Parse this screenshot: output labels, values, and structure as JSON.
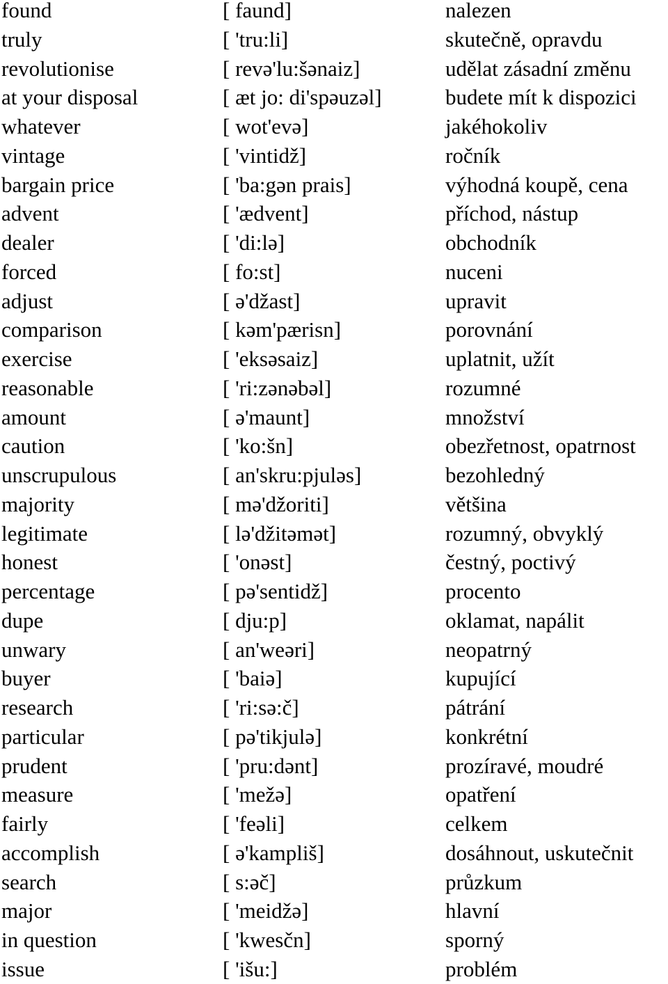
{
  "vocabulary": [
    {
      "word": "found",
      "pronunciation": "[ faund]",
      "translation": "nalezen"
    },
    {
      "word": "truly",
      "pronunciation": "[ 'tru:li]",
      "translation": "skutečně, opravdu"
    },
    {
      "word": "revolutionise",
      "pronunciation": "[ revə'lu:šənaiz]",
      "translation": "udělat zásadní změnu"
    },
    {
      "word": "at your disposal",
      "pronunciation": "[ æt jo: di'spəuzəl]",
      "translation": "budete mít k dispozici"
    },
    {
      "word": "whatever",
      "pronunciation": "[ wot'evə]",
      "translation": "jakéhokoliv"
    },
    {
      "word": "vintage",
      "pronunciation": "[ 'vintidž]",
      "translation": "ročník"
    },
    {
      "word": "bargain price",
      "pronunciation": "[ 'ba:gən prais]",
      "translation": "výhodná koupě, cena"
    },
    {
      "word": "advent",
      "pronunciation": "[ 'ædvent]",
      "translation": "příchod, nástup"
    },
    {
      "word": "dealer",
      "pronunciation": "[ 'di:lə]",
      "translation": "obchodník"
    },
    {
      "word": "forced",
      "pronunciation": "[ fo:st]",
      "translation": "nuceni"
    },
    {
      "word": "adjust",
      "pronunciation": "[ ə'džast]",
      "translation": "upravit"
    },
    {
      "word": "comparison",
      "pronunciation": "[ kəm'pærisn]",
      "translation": "porovnání"
    },
    {
      "word": "exercise",
      "pronunciation": "[ 'eksəsaiz]",
      "translation": "uplatnit, užít"
    },
    {
      "word": "reasonable",
      "pronunciation": "[ 'ri:zənəbəl]",
      "translation": "rozumné"
    },
    {
      "word": "amount",
      "pronunciation": "[ ə'maunt]",
      "translation": "množství"
    },
    {
      "word": "caution",
      "pronunciation": "[ 'ko:šn]",
      "translation": "obezřetnost, opatrnost"
    },
    {
      "word": "unscrupulous",
      "pronunciation": "[ an'skru:pjuləs]",
      "translation": "bezohledný"
    },
    {
      "word": "majority",
      "pronunciation": "[ mə'džoriti]",
      "translation": "většina"
    },
    {
      "word": "legitimate",
      "pronunciation": "[ lə'džitəmət]",
      "translation": "rozumný, obvyklý"
    },
    {
      "word": "honest",
      "pronunciation": "[ 'onəst]",
      "translation": "čestný, poctivý"
    },
    {
      "word": "percentage",
      "pronunciation": "[ pə'sentidž]",
      "translation": "procento"
    },
    {
      "word": "dupe",
      "pronunciation": "[ dju:p]",
      "translation": "oklamat, napálit"
    },
    {
      "word": "unwary",
      "pronunciation": "[ an'weəri]",
      "translation": "neopatrný"
    },
    {
      "word": "buyer",
      "pronunciation": "[ 'baiə]",
      "translation": "kupující"
    },
    {
      "word": "research",
      "pronunciation": "[ 'ri:sə:č]",
      "translation": "pátrání"
    },
    {
      "word": "particular",
      "pronunciation": "[ pə'tikjulə]",
      "translation": "konkrétní"
    },
    {
      "word": "prudent",
      "pronunciation": "[ 'pru:dənt]",
      "translation": "prozíravé, moudré"
    },
    {
      "word": "measure",
      "pronunciation": "[ 'mežə]",
      "translation": "opatření"
    },
    {
      "word": "fairly",
      "pronunciation": "[ 'feəli]",
      "translation": "celkem"
    },
    {
      "word": "accomplish",
      "pronunciation": "[ ə'kampliš]",
      "translation": "dosáhnout, uskutečnit"
    },
    {
      "word": "search",
      "pronunciation": "[ s:əč]",
      "translation": "průzkum"
    },
    {
      "word": "major",
      "pronunciation": "[ 'meidžə]",
      "translation": "hlavní"
    },
    {
      "word": "in question",
      "pronunciation": "[ 'kwesčn]",
      "translation": "sporný"
    },
    {
      "word": "issue",
      "pronunciation": "[ 'išu:]",
      "translation": "problém"
    }
  ]
}
